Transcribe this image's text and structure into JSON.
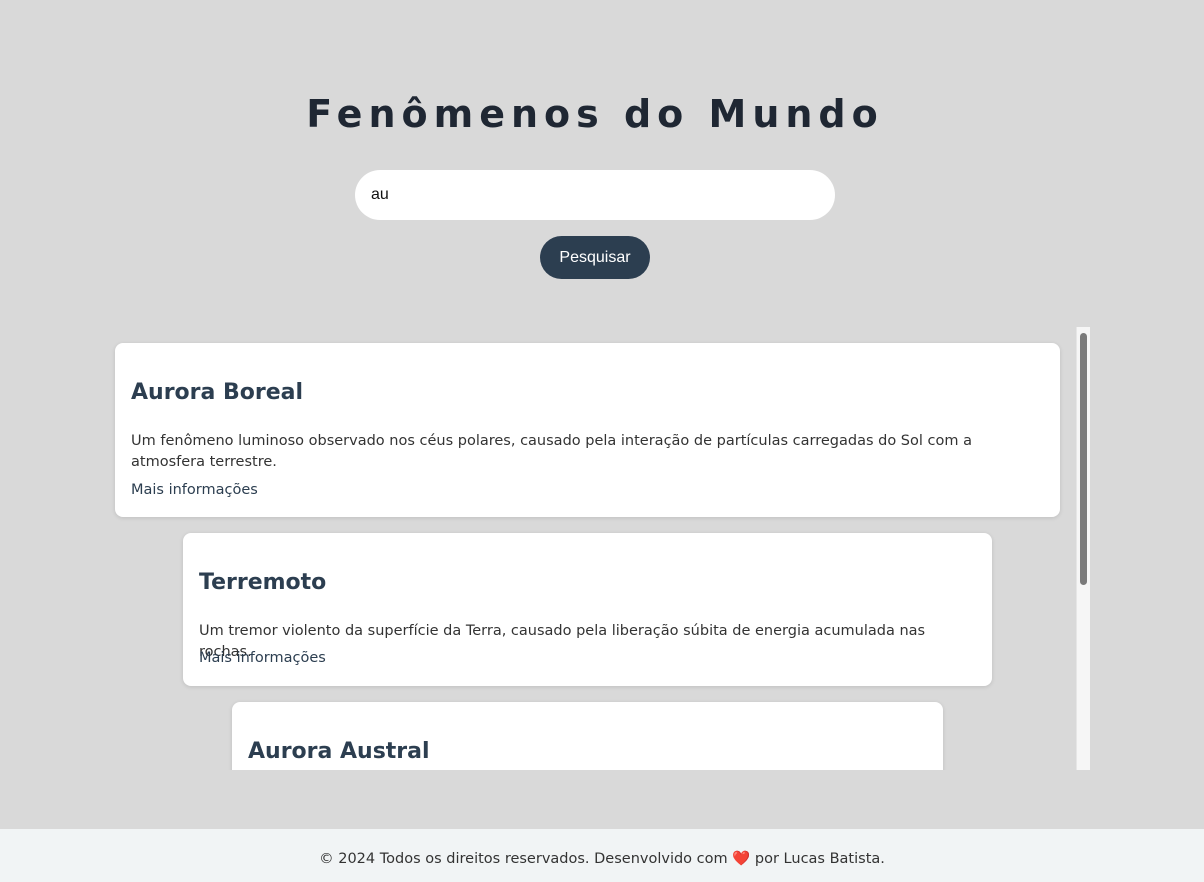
{
  "header": {
    "title": "Fenômenos do Mundo"
  },
  "search": {
    "value": "au",
    "button_label": "Pesquisar"
  },
  "results": [
    {
      "title": "Aurora Boreal",
      "description": "Um fenômeno luminoso observado nos céus polares, causado pela interação de partículas carregadas do Sol com a atmosfera terrestre.",
      "link_label": "Mais informações"
    },
    {
      "title": "Terremoto",
      "description": "Um tremor violento da superfície da Terra, causado pela liberação súbita de energia acumulada nas rochas.",
      "link_label": "Mais informações"
    },
    {
      "title": "Aurora Austral"
    }
  ],
  "footer": {
    "text_before": "© 2024 Todos os direitos reservados. Desenvolvido com",
    "heart_icon": "heart-icon",
    "heart_glyph": "❤️",
    "text_after": "por Lucas Batista."
  },
  "colors": {
    "background": "#d9d9d9",
    "accent": "#2c3e50",
    "card": "#ffffff"
  }
}
